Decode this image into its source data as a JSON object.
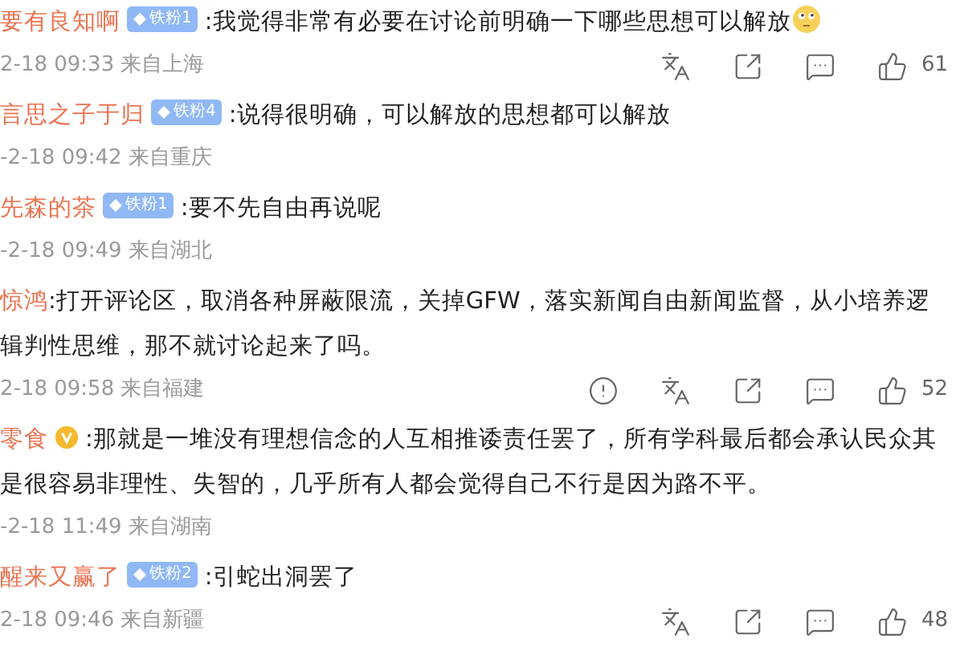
{
  "comments": [
    {
      "name": "要有良知啊",
      "badge": {
        "kind": "fan",
        "label": "铁粉1"
      },
      "text": ":我觉得非常有必要在讨论前明确一下哪些思想可以解放",
      "emoji": true,
      "meta": "2-18 09:33 来自上海",
      "actions": [
        {
          "kind": "translate"
        },
        {
          "kind": "share"
        },
        {
          "kind": "comment"
        },
        {
          "kind": "like"
        }
      ],
      "likes": "61"
    },
    {
      "name": "言思之子于归",
      "badge": {
        "kind": "fan",
        "label": "铁粉4"
      },
      "text": ":说得很明确，可以解放的思想都可以解放",
      "meta": "-2-18 09:42 来自重庆"
    },
    {
      "name": "先森的茶",
      "badge": {
        "kind": "fan",
        "label": "铁粉1"
      },
      "text": ":要不先自由再说呢",
      "meta": "-2-18 09:49 来自湖北"
    },
    {
      "name": "惊鸿",
      "text": ":打开评论区，取消各种屏蔽限流，关掉GFW，落实新闻自由新闻监督，从小培养逻辑判性思维，那不就讨论起来了吗。",
      "meta": "2-18 09:58 来自福建",
      "actions": [
        {
          "kind": "report"
        },
        {
          "kind": "translate"
        },
        {
          "kind": "share"
        },
        {
          "kind": "comment"
        },
        {
          "kind": "like"
        }
      ],
      "likes": "52"
    },
    {
      "name": "零食",
      "badge": {
        "kind": "verified"
      },
      "text": ":那就是一堆没有理想信念的人互相推诿责任罢了，所有学科最后都会承认民众其是很容易非理性、失智的，几乎所有人都会觉得自己不行是因为路不平。",
      "meta": "-2-18 11:49 来自湖南"
    },
    {
      "name": "醒来又赢了",
      "badge": {
        "kind": "fan",
        "label": "铁粉2"
      },
      "text": ":引蛇出洞罢了",
      "meta": "2-18 09:46 来自新疆",
      "actions": [
        {
          "kind": "translate"
        },
        {
          "kind": "share"
        },
        {
          "kind": "comment"
        },
        {
          "kind": "like"
        }
      ],
      "likes": "48"
    }
  ]
}
